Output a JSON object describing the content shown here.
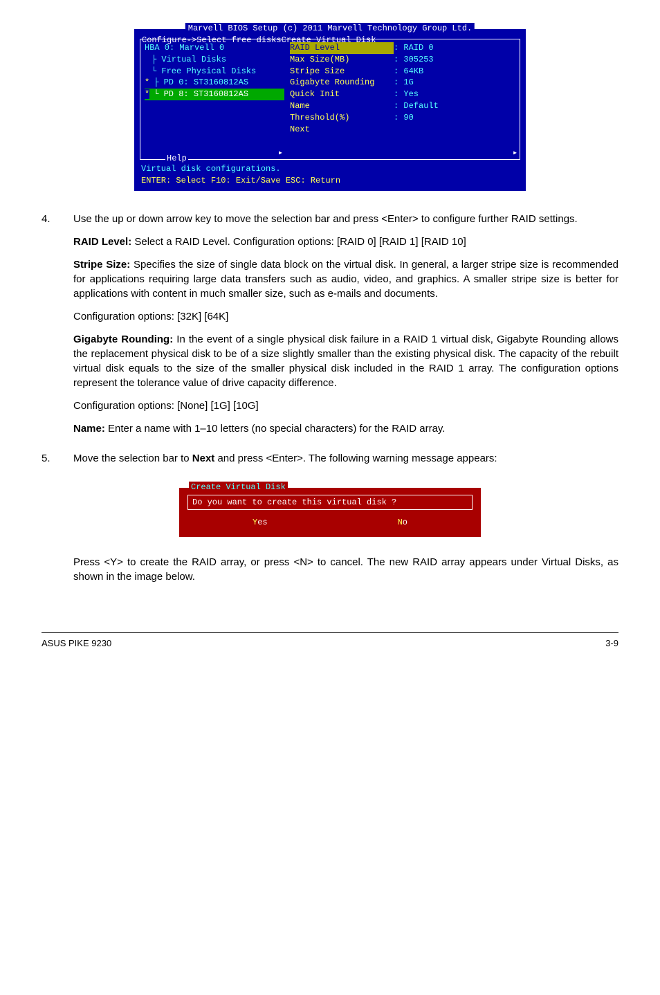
{
  "bios": {
    "title": "Marvell BIOS Setup (c) 2011 Marvell Technology Group Ltd.",
    "subtitle": "Configure->Select free disksCreate Virtual Disk",
    "left": {
      "hba": "HBA 0: Marvell 0",
      "vdisks": "Virtual Disks",
      "pdisks": "Free Physical Disks",
      "pd0": "PD 0: ST3160812AS",
      "pd8": "PD 8: ST3160812AS",
      "star": "*"
    },
    "right": {
      "raid_label": "RAID Level",
      "raid_val": ": RAID 0",
      "max_label": "Max Size(MB)",
      "max_val": ": 305253",
      "stripe_label": "Stripe Size",
      "stripe_val": ": 64KB",
      "gig_label": "Gigabyte Rounding",
      "gig_val": ": 1G",
      "quick_label": "Quick Init",
      "quick_val": ": Yes",
      "name_label": "Name",
      "name_val": ": Default",
      "thresh_label": "Threshold(%)",
      "thresh_val": ": 90",
      "next_label": "Next"
    },
    "help": "Help",
    "footer1": "Virtual disk configurations.",
    "footer2": "ENTER: Select   F10: Exit/Save   ESC: Return"
  },
  "step4": {
    "num": "4.",
    "p1": "Use the up or down arrow key to move the selection bar and press <Enter> to configure further RAID settings.",
    "raid_b": "RAID Level:",
    "raid_t": " Select a RAID Level. Configuration options: [RAID 0] [RAID 1] [RAID 10]",
    "stripe_b": "Stripe Size:",
    "stripe_t": " Specifies the size of single data block on the virtual disk. In general, a larger stripe size is recommended for applications requiring large data transfers such as audio, video, and graphics. A smaller stripe size is better for applications with content in much smaller size, such as e-mails and documents.",
    "stripe_cfg": "Configuration options: [32K] [64K]",
    "gig_b": "Gigabyte Rounding:",
    "gig_t": " In the event of a single physical disk failure in a RAID 1 virtual disk, Gigabyte Rounding allows the replacement physical disk to be of a size slightly smaller than the existing physical disk. The capacity of the rebuilt virtual disk equals to the size of the smaller physical disk included in the RAID 1 array. The configuration options represent the tolerance value of drive capacity difference.",
    "gig_cfg": "Configuration options: [None] [1G] [10G]",
    "name_b": "Name:",
    "name_t": " Enter a name with 1–10 letters (no special characters) for the RAID array."
  },
  "step5": {
    "num": "5.",
    "p1a": "Move the selection bar to ",
    "p1b": "Next",
    "p1c": " and press <Enter>. The following warning message appears:"
  },
  "dialog": {
    "title": "Create Virtual Disk",
    "msg": "Do you want to create this virtual disk ?",
    "yes_hot": "Y",
    "yes": "es",
    "no_hot": "N",
    "no": "o"
  },
  "after": "Press <Y> to create the RAID array, or press <N> to cancel. The new RAID array appears under Virtual Disks, as shown in the image below.",
  "footer": {
    "left": "ASUS PIKE 9230",
    "right": "3-9"
  }
}
